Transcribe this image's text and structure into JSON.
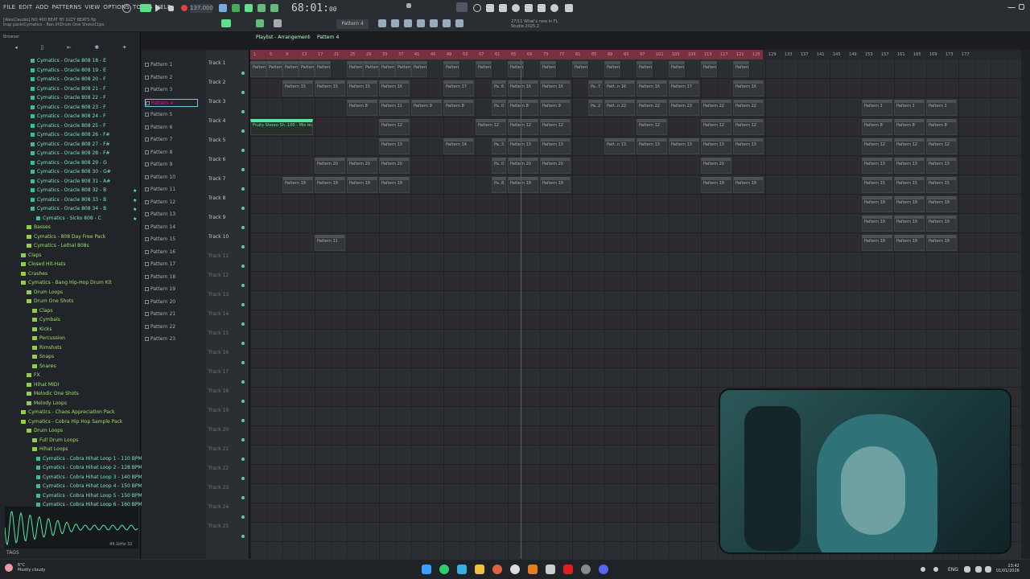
{
  "menu": [
    "FILE",
    "EDIT",
    "ADD",
    "PATTERNS",
    "VIEW",
    "OPTIONS",
    "TOOLS",
    "HELP"
  ],
  "transport": {
    "tempo": "137.000",
    "time": "68:01",
    "time_small": "00",
    "pattern": "Pattern 4"
  },
  "project": {
    "title": "[AlexClaudio] NO 400 BEAT BY LUZY BEATS.flp",
    "path": "trap pack\\Cymatics - Ban.ill\\Drum One Shots\\Clips"
  },
  "news": [
    "27/11 What's new in FL",
    "Studio 2025.2"
  ],
  "browser": {
    "header": "Browser",
    "items": [
      {
        "label": "Cymatics - Oracle 808 18 - E",
        "type": "file",
        "indent": 2
      },
      {
        "label": "Cymatics - Oracle 808 19 - E",
        "type": "file",
        "indent": 2
      },
      {
        "label": "Cymatics - Oracle 808 20 - F",
        "type": "file",
        "indent": 2
      },
      {
        "label": "Cymatics - Oracle 808 21 - F",
        "type": "file",
        "indent": 2
      },
      {
        "label": "Cymatics - Oracle 808 22 - F",
        "type": "file",
        "indent": 2
      },
      {
        "label": "Cymatics - Oracle 808 23 - F",
        "type": "file",
        "indent": 2
      },
      {
        "label": "Cymatics - Oracle 808 24 - F",
        "type": "file",
        "indent": 2
      },
      {
        "label": "Cymatics - Oracle 808 25 - F",
        "type": "file",
        "indent": 2
      },
      {
        "label": "Cymatics - Oracle 808 26 - F#",
        "type": "file",
        "indent": 2
      },
      {
        "label": "Cymatics - Oracle 808 27 - F#",
        "type": "file",
        "indent": 2
      },
      {
        "label": "Cymatics - Oracle 808 28 - F#",
        "type": "file",
        "indent": 2
      },
      {
        "label": "Cymatics - Oracle 808 29 - G",
        "type": "file",
        "indent": 2
      },
      {
        "label": "Cymatics - Oracle 808 30 - G#",
        "type": "file",
        "indent": 2
      },
      {
        "label": "Cymatics - Oracle 808 31 - A#",
        "type": "file",
        "indent": 2
      },
      {
        "label": "Cymatics - Oracle 808 32 - B",
        "type": "file",
        "indent": 2
      },
      {
        "label": "Cymatics - Oracle 808 33 - B",
        "type": "file",
        "indent": 2
      },
      {
        "label": "Cymatics - Oracle 808 34 - B",
        "type": "file",
        "indent": 2
      },
      {
        "label": "Cymatics - Sicko 808 - C",
        "type": "file",
        "indent": 3
      },
      {
        "label": "Basses",
        "type": "folder",
        "indent": 1
      },
      {
        "label": "Cymatics - 808 Day Free Pack",
        "type": "folder",
        "indent": 1
      },
      {
        "label": "Cymatics - Lethal 808s",
        "type": "folder",
        "indent": 1
      },
      {
        "label": "Claps",
        "type": "folder",
        "indent": 0
      },
      {
        "label": "Closed Hit-Hats",
        "type": "folder",
        "indent": 0
      },
      {
        "label": "Crashes",
        "type": "folder",
        "indent": 0
      },
      {
        "label": "Cymatics - Bang Hip-Hop Drum Kit",
        "type": "folder",
        "indent": 0
      },
      {
        "label": "Drum Loops",
        "type": "folder",
        "indent": 1
      },
      {
        "label": "Drum One Shots",
        "type": "folder",
        "indent": 1
      },
      {
        "label": "Claps",
        "type": "folder",
        "indent": 2
      },
      {
        "label": "Cymbals",
        "type": "folder",
        "indent": 2
      },
      {
        "label": "Kicks",
        "type": "folder",
        "indent": 2
      },
      {
        "label": "Percussion",
        "type": "folder",
        "indent": 2
      },
      {
        "label": "Rimshots",
        "type": "folder",
        "indent": 2
      },
      {
        "label": "Snaps",
        "type": "folder",
        "indent": 2
      },
      {
        "label": "Snares",
        "type": "folder",
        "indent": 2
      },
      {
        "label": "FX",
        "type": "folder",
        "indent": 1
      },
      {
        "label": "Hihat MIDI",
        "type": "folder",
        "indent": 1
      },
      {
        "label": "Melodic One Shots",
        "type": "folder",
        "indent": 1
      },
      {
        "label": "Melody Loops",
        "type": "folder",
        "indent": 1
      },
      {
        "label": "Cymatics - Chaos Appreciation Pack",
        "type": "folder",
        "indent": 0
      },
      {
        "label": "Cymatics - Cobra Hip Hop Sample Pack",
        "type": "folder",
        "indent": 0
      },
      {
        "label": "Drum Loops",
        "type": "folder",
        "indent": 1
      },
      {
        "label": "Full Drum Loops",
        "type": "folder",
        "indent": 2
      },
      {
        "label": "Hihat Loops",
        "type": "folder",
        "indent": 2
      },
      {
        "label": "Cymatics - Cobra Hihat Loop 1 - 110 BPM",
        "type": "file",
        "indent": 3
      },
      {
        "label": "Cymatics - Cobra Hihat Loop 2 - 128 BPM",
        "type": "file",
        "indent": 3
      },
      {
        "label": "Cymatics - Cobra Hihat Loop 3 - 140 BPM",
        "type": "file",
        "indent": 3
      },
      {
        "label": "Cymatics - Cobra Hihat Loop 4 - 150 BPM",
        "type": "file",
        "indent": 3
      },
      {
        "label": "Cymatics - Cobra Hihat Loop 5 - 150 BPM",
        "type": "file",
        "indent": 3
      },
      {
        "label": "Cymatics - Cobra Hihat Loop 6 - 160 BPM",
        "type": "file",
        "indent": 3
      },
      {
        "label": "Percussion Loops",
        "type": "folder",
        "indent": 2
      }
    ],
    "tags_label": "TAGS",
    "sample_info": "44.1kHz 32"
  },
  "picker": [
    "Pattern 1",
    "Pattern 2",
    "Pattern 3",
    "Pattern 4",
    "Pattern 5",
    "Pattern 6",
    "Pattern 7",
    "Pattern 8",
    "Pattern 9",
    "Pattern 10",
    "Pattern 11",
    "Pattern 12",
    "Pattern 13",
    "Pattern 14",
    "Pattern 15",
    "Pattern 16",
    "Pattern 17",
    "Pattern 18",
    "Pattern 19",
    "Pattern 20",
    "Pattern 21",
    "Pattern 22",
    "Pattern 23"
  ],
  "picker_selected": 3,
  "playlist": {
    "title": "Playlist - Arrangement",
    "pattern": "Pattern 4",
    "tracks": [
      "Track 1",
      "Track 2",
      "Track 3",
      "Track 4",
      "Track 5",
      "Track 6",
      "Track 7",
      "Track 8",
      "Track 9",
      "Track 10",
      "Track 11",
      "Track 12",
      "Track 13",
      "Track 14",
      "Track 15",
      "Track 16",
      "Track 17",
      "Track 18",
      "Track 19",
      "Track 20",
      "Track 21",
      "Track 22",
      "Track 23",
      "Track 24",
      "Track 25"
    ],
    "ruler": [
      "1",
      "5",
      "9",
      "13",
      "17",
      "21",
      "25",
      "29",
      "33",
      "37",
      "41",
      "45",
      "49",
      "53",
      "57",
      "61",
      "65",
      "69",
      "73",
      "77",
      "81",
      "85",
      "89",
      "93",
      "97",
      "101",
      "105",
      "109",
      "113",
      "117",
      "121",
      "125",
      "129",
      "133",
      "137",
      "141",
      "145",
      "149",
      "153",
      "157",
      "161",
      "165",
      "169",
      "173",
      "177"
    ],
    "clips": [
      {
        "track": 0,
        "bar": 0,
        "len": 20,
        "label": "Pattern 3"
      },
      {
        "track": 0,
        "bar": 20,
        "len": 20,
        "label": "Pattern 3"
      },
      {
        "track": 0,
        "bar": 40,
        "len": 20,
        "label": "Pattern 3"
      },
      {
        "track": 0,
        "bar": 60,
        "len": 20,
        "label": "Pattern 3"
      },
      {
        "track": 0,
        "bar": 80,
        "len": 20,
        "label": "Pattern 3"
      },
      {
        "track": 0,
        "bar": 120,
        "len": 20,
        "label": "Pattern 4"
      },
      {
        "track": 0,
        "bar": 140,
        "len": 20,
        "label": "Pattern 4"
      },
      {
        "track": 0,
        "bar": 160,
        "len": 20,
        "label": "Pattern 4"
      },
      {
        "track": 0,
        "bar": 180,
        "len": 20,
        "label": "Pattern 4"
      },
      {
        "track": 0,
        "bar": 200,
        "len": 20,
        "label": "Pattern 4"
      },
      {
        "track": 0,
        "bar": 240,
        "len": 20,
        "label": "Pattern 4"
      },
      {
        "track": 0,
        "bar": 280,
        "len": 20,
        "label": "Pattern 4"
      },
      {
        "track": 0,
        "bar": 320,
        "len": 20,
        "label": "Pattern 4"
      },
      {
        "track": 0,
        "bar": 360,
        "len": 20,
        "label": "Pattern 4"
      },
      {
        "track": 0,
        "bar": 400,
        "len": 20,
        "label": "Pattern 6"
      },
      {
        "track": 0,
        "bar": 440,
        "len": 20,
        "label": "Pattern 6"
      },
      {
        "track": 0,
        "bar": 480,
        "len": 20,
        "label": "Pattern 6"
      },
      {
        "track": 0,
        "bar": 520,
        "len": 20,
        "label": "Pattern 6"
      },
      {
        "track": 0,
        "bar": 560,
        "len": 20,
        "label": "Pattern 7"
      },
      {
        "track": 0,
        "bar": 600,
        "len": 20,
        "label": "Pattern 6"
      },
      {
        "track": 1,
        "bar": 40,
        "len": 38,
        "label": "Pattern 15"
      },
      {
        "track": 1,
        "bar": 80,
        "len": 38,
        "label": "Pattern 15"
      },
      {
        "track": 1,
        "bar": 120,
        "len": 38,
        "label": "Pattern 15"
      },
      {
        "track": 1,
        "bar": 160,
        "len": 38,
        "label": "Pattern 16"
      },
      {
        "track": 1,
        "bar": 240,
        "len": 38,
        "label": "Pattern 17"
      },
      {
        "track": 1,
        "bar": 300,
        "len": 18,
        "label": "Pa..6"
      },
      {
        "track": 1,
        "bar": 320,
        "len": 38,
        "label": "Pattern 16"
      },
      {
        "track": 1,
        "bar": 360,
        "len": 38,
        "label": "Pattern 16"
      },
      {
        "track": 1,
        "bar": 420,
        "len": 18,
        "label": "Pa..7"
      },
      {
        "track": 1,
        "bar": 440,
        "len": 38,
        "label": "Patt..n 16"
      },
      {
        "track": 1,
        "bar": 480,
        "len": 38,
        "label": "Pattern 16"
      },
      {
        "track": 1,
        "bar": 520,
        "len": 38,
        "label": "Pattern 17"
      },
      {
        "track": 1,
        "bar": 600,
        "len": 38,
        "label": "Pattern 16"
      },
      {
        "track": 2,
        "bar": 120,
        "len": 38,
        "label": "Pattern 8"
      },
      {
        "track": 2,
        "bar": 160,
        "len": 38,
        "label": "Pattern 11"
      },
      {
        "track": 2,
        "bar": 200,
        "len": 38,
        "label": "Pattern 9"
      },
      {
        "track": 2,
        "bar": 240,
        "len": 38,
        "label": "Pattern 8"
      },
      {
        "track": 2,
        "bar": 300,
        "len": 18,
        "label": "Pa..0"
      },
      {
        "track": 2,
        "bar": 320,
        "len": 38,
        "label": "Pattern 8"
      },
      {
        "track": 2,
        "bar": 360,
        "len": 38,
        "label": "Pattern 9"
      },
      {
        "track": 2,
        "bar": 420,
        "len": 18,
        "label": "Pa..2"
      },
      {
        "track": 2,
        "bar": 440,
        "len": 38,
        "label": "Patt..n 22"
      },
      {
        "track": 2,
        "bar": 480,
        "len": 38,
        "label": "Pattern 22"
      },
      {
        "track": 2,
        "bar": 520,
        "len": 38,
        "label": "Pattern 23"
      },
      {
        "track": 2,
        "bar": 560,
        "len": 38,
        "label": "Pattern 22"
      },
      {
        "track": 2,
        "bar": 600,
        "len": 38,
        "label": "Pattern 22"
      },
      {
        "track": 2,
        "bar": 760,
        "len": 38,
        "label": "Pattern 1"
      },
      {
        "track": 2,
        "bar": 800,
        "len": 38,
        "label": "Pattern 1"
      },
      {
        "track": 2,
        "bar": 840,
        "len": 38,
        "label": "Pattern 1"
      },
      {
        "track": 3,
        "bar": 0,
        "len": 78,
        "label": "Fruity Stereo Sh..100 - Mix level",
        "auto": true
      },
      {
        "track": 3,
        "bar": 160,
        "len": 38,
        "label": "Pattern 12"
      },
      {
        "track": 3,
        "bar": 280,
        "len": 38,
        "label": "Pattern 12"
      },
      {
        "track": 3,
        "bar": 320,
        "len": 38,
        "label": "Pattern 12"
      },
      {
        "track": 3,
        "bar": 360,
        "len": 38,
        "label": "Pattern 12"
      },
      {
        "track": 3,
        "bar": 480,
        "len": 38,
        "label": "Pattern 12"
      },
      {
        "track": 3,
        "bar": 560,
        "len": 38,
        "label": "Pattern 12"
      },
      {
        "track": 3,
        "bar": 600,
        "len": 38,
        "label": "Pattern 12"
      },
      {
        "track": 3,
        "bar": 760,
        "len": 38,
        "label": "Pattern 8"
      },
      {
        "track": 3,
        "bar": 800,
        "len": 38,
        "label": "Pattern 8"
      },
      {
        "track": 3,
        "bar": 840,
        "len": 38,
        "label": "Pattern 8"
      },
      {
        "track": 4,
        "bar": 160,
        "len": 38,
        "label": "Pattern 13"
      },
      {
        "track": 4,
        "bar": 240,
        "len": 38,
        "label": "Pattern 14"
      },
      {
        "track": 4,
        "bar": 300,
        "len": 18,
        "label": "Pa..3"
      },
      {
        "track": 4,
        "bar": 320,
        "len": 38,
        "label": "Pattern 13"
      },
      {
        "track": 4,
        "bar": 360,
        "len": 38,
        "label": "Pattern 13"
      },
      {
        "track": 4,
        "bar": 440,
        "len": 38,
        "label": "Patt..n 13"
      },
      {
        "track": 4,
        "bar": 480,
        "len": 38,
        "label": "Pattern 13"
      },
      {
        "track": 4,
        "bar": 520,
        "len": 38,
        "label": "Pattern 13"
      },
      {
        "track": 4,
        "bar": 560,
        "len": 38,
        "label": "Pattern 13"
      },
      {
        "track": 4,
        "bar": 600,
        "len": 38,
        "label": "Pattern 13"
      },
      {
        "track": 4,
        "bar": 760,
        "len": 38,
        "label": "Pattern 12"
      },
      {
        "track": 4,
        "bar": 800,
        "len": 38,
        "label": "Pattern 12"
      },
      {
        "track": 4,
        "bar": 840,
        "len": 38,
        "label": "Pattern 12"
      },
      {
        "track": 5,
        "bar": 80,
        "len": 38,
        "label": "Pattern 20"
      },
      {
        "track": 5,
        "bar": 120,
        "len": 38,
        "label": "Pattern 20"
      },
      {
        "track": 5,
        "bar": 160,
        "len": 38,
        "label": "Pattern 20"
      },
      {
        "track": 5,
        "bar": 300,
        "len": 18,
        "label": "Pa..0"
      },
      {
        "track": 5,
        "bar": 320,
        "len": 38,
        "label": "Pattern 20"
      },
      {
        "track": 5,
        "bar": 360,
        "len": 38,
        "label": "Pattern 20"
      },
      {
        "track": 5,
        "bar": 560,
        "len": 38,
        "label": "Pattern 20"
      },
      {
        "track": 5,
        "bar": 760,
        "len": 38,
        "label": "Pattern 13"
      },
      {
        "track": 5,
        "bar": 800,
        "len": 38,
        "label": "Pattern 13"
      },
      {
        "track": 5,
        "bar": 840,
        "len": 38,
        "label": "Pattern 13"
      },
      {
        "track": 6,
        "bar": 40,
        "len": 38,
        "label": "Pattern 18"
      },
      {
        "track": 6,
        "bar": 80,
        "len": 38,
        "label": "Pattern 18"
      },
      {
        "track": 6,
        "bar": 120,
        "len": 38,
        "label": "Pattern 18"
      },
      {
        "track": 6,
        "bar": 160,
        "len": 38,
        "label": "Pattern 18"
      },
      {
        "track": 6,
        "bar": 300,
        "len": 18,
        "label": "Pa..8"
      },
      {
        "track": 6,
        "bar": 320,
        "len": 38,
        "label": "Pattern 18"
      },
      {
        "track": 6,
        "bar": 360,
        "len": 38,
        "label": "Pattern 18"
      },
      {
        "track": 6,
        "bar": 560,
        "len": 38,
        "label": "Pattern 18"
      },
      {
        "track": 6,
        "bar": 600,
        "len": 38,
        "label": "Pattern 18"
      },
      {
        "track": 6,
        "bar": 760,
        "len": 38,
        "label": "Pattern 15"
      },
      {
        "track": 6,
        "bar": 800,
        "len": 38,
        "label": "Pattern 15"
      },
      {
        "track": 6,
        "bar": 840,
        "len": 38,
        "label": "Pattern 15"
      },
      {
        "track": 7,
        "bar": 760,
        "len": 38,
        "label": "Pattern 18"
      },
      {
        "track": 7,
        "bar": 800,
        "len": 38,
        "label": "Pattern 18"
      },
      {
        "track": 7,
        "bar": 840,
        "len": 38,
        "label": "Pattern 18"
      },
      {
        "track": 8,
        "bar": 760,
        "len": 38,
        "label": "Pattern 19"
      },
      {
        "track": 8,
        "bar": 800,
        "len": 38,
        "label": "Pattern 19"
      },
      {
        "track": 8,
        "bar": 840,
        "len": 38,
        "label": "Pattern 19"
      },
      {
        "track": 9,
        "bar": 80,
        "len": 38,
        "label": "Pattern 11"
      },
      {
        "track": 9,
        "bar": 760,
        "len": 38,
        "label": "Pattern 18"
      },
      {
        "track": 9,
        "bar": 800,
        "len": 38,
        "label": "Pattern 18"
      },
      {
        "track": 9,
        "bar": 840,
        "len": 38,
        "label": "Pattern 18"
      }
    ]
  },
  "taskbar": {
    "weather_temp": "6°C",
    "weather_desc": "Mostly cloudy",
    "lang": "ENG",
    "time": "13:42",
    "date": "01/01/2026"
  }
}
